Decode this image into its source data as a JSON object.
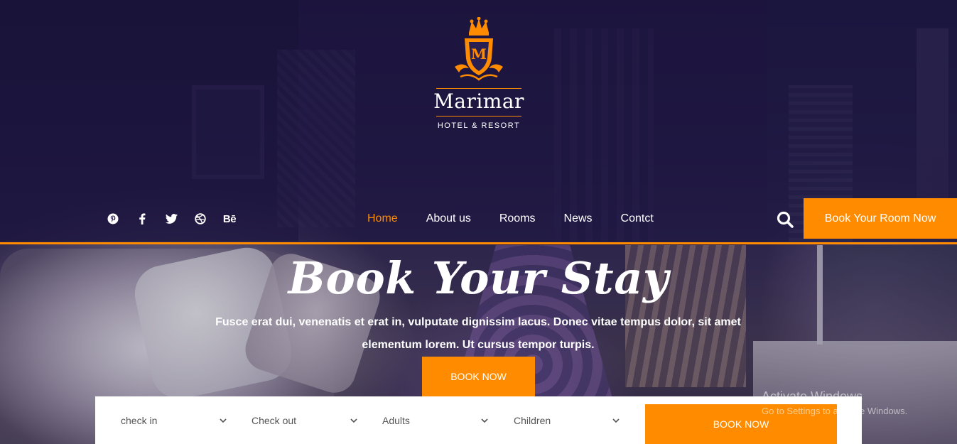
{
  "brand": {
    "logo_letter": "M",
    "name": "Marimar",
    "tagline": "HOTEL & RESORT"
  },
  "social": [
    {
      "icon": "pinterest-icon"
    },
    {
      "icon": "facebook-icon"
    },
    {
      "icon": "twitter-icon"
    },
    {
      "icon": "dribbble-icon"
    },
    {
      "icon": "behance-icon",
      "label": "Bē"
    }
  ],
  "nav": {
    "items": [
      {
        "label": "Home",
        "active": true
      },
      {
        "label": "About us"
      },
      {
        "label": "Rooms"
      },
      {
        "label": "News"
      },
      {
        "label": "Contct"
      }
    ]
  },
  "header": {
    "book_room_label": "Book Your Room Now"
  },
  "hero": {
    "title": "Book Your Stay",
    "text": "Fusce erat dui, venenatis et erat in, vulputate dignissim lacus. Donec vitae tempus dolor, sit amet elementum lorem. Ut cursus tempor turpis.",
    "button_label": "BOOK NOW"
  },
  "booking": {
    "check_in": "check in",
    "check_out": "Check out",
    "adults": "Adults",
    "children": "Children",
    "submit_label": "BOOK NOW"
  },
  "watermark": {
    "title": "Activate Windows",
    "subtitle": "Go to Settings to activate Windows."
  },
  "colors": {
    "accent": "#ff8c00",
    "header_bg": "#1c143e",
    "text_light": "#ffffff",
    "field_text": "#555555"
  }
}
